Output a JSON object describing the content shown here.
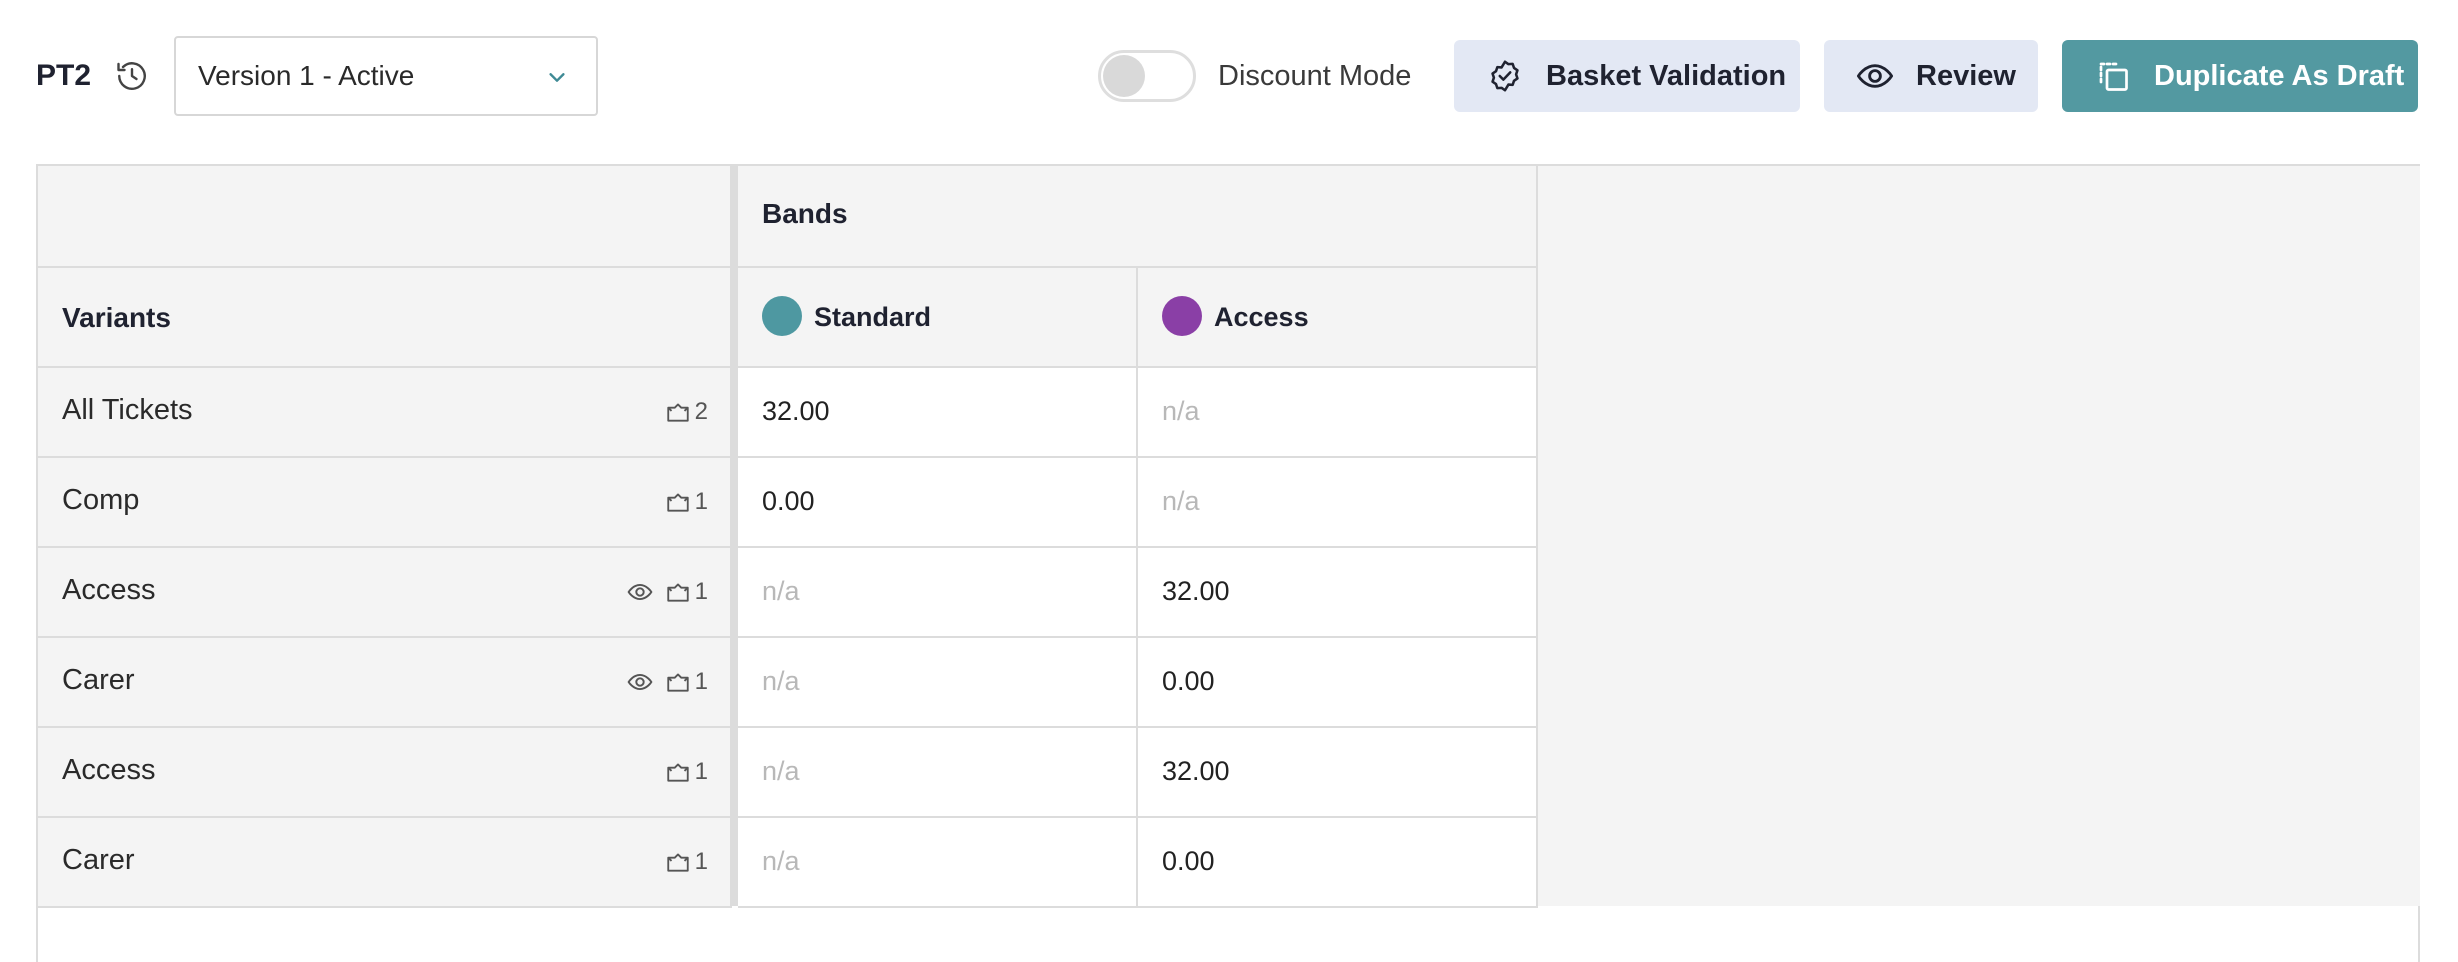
{
  "toolbar": {
    "title": "PT2",
    "version_value": "Version 1 - Active",
    "discount_label": "Discount Mode",
    "discount_on": false,
    "basket_label": "Basket Validation",
    "review_label": "Review",
    "duplicate_label": "Duplicate As Draft"
  },
  "grid": {
    "bands_header": "Bands",
    "variants_header": "Variants",
    "bands": [
      {
        "name": "Standard",
        "color": "#4e98a1"
      },
      {
        "name": "Access",
        "color": "#8a3fa6"
      }
    ],
    "rows": [
      {
        "label": "All Tickets",
        "visibility_icon": false,
        "count": "2",
        "prices": [
          "32.00",
          "n/a"
        ]
      },
      {
        "label": "Comp",
        "visibility_icon": false,
        "count": "1",
        "prices": [
          "0.00",
          "n/a"
        ]
      },
      {
        "label": "Access",
        "visibility_icon": true,
        "count": "1",
        "prices": [
          "n/a",
          "32.00"
        ]
      },
      {
        "label": "Carer",
        "visibility_icon": true,
        "count": "1",
        "prices": [
          "n/a",
          "0.00"
        ]
      },
      {
        "label": "Access",
        "visibility_icon": false,
        "count": "1",
        "prices": [
          "n/a",
          "32.00"
        ]
      },
      {
        "label": "Carer",
        "visibility_icon": false,
        "count": "1",
        "prices": [
          "n/a",
          "0.00"
        ]
      }
    ]
  },
  "colors": {
    "accent": "#5399a1",
    "secondary_button_bg": "#e3e8f4"
  },
  "icons": [
    "history-icon",
    "chevron-down-icon",
    "badge-check-icon",
    "eye-icon",
    "duplicate-icon",
    "ticket-icon"
  ]
}
